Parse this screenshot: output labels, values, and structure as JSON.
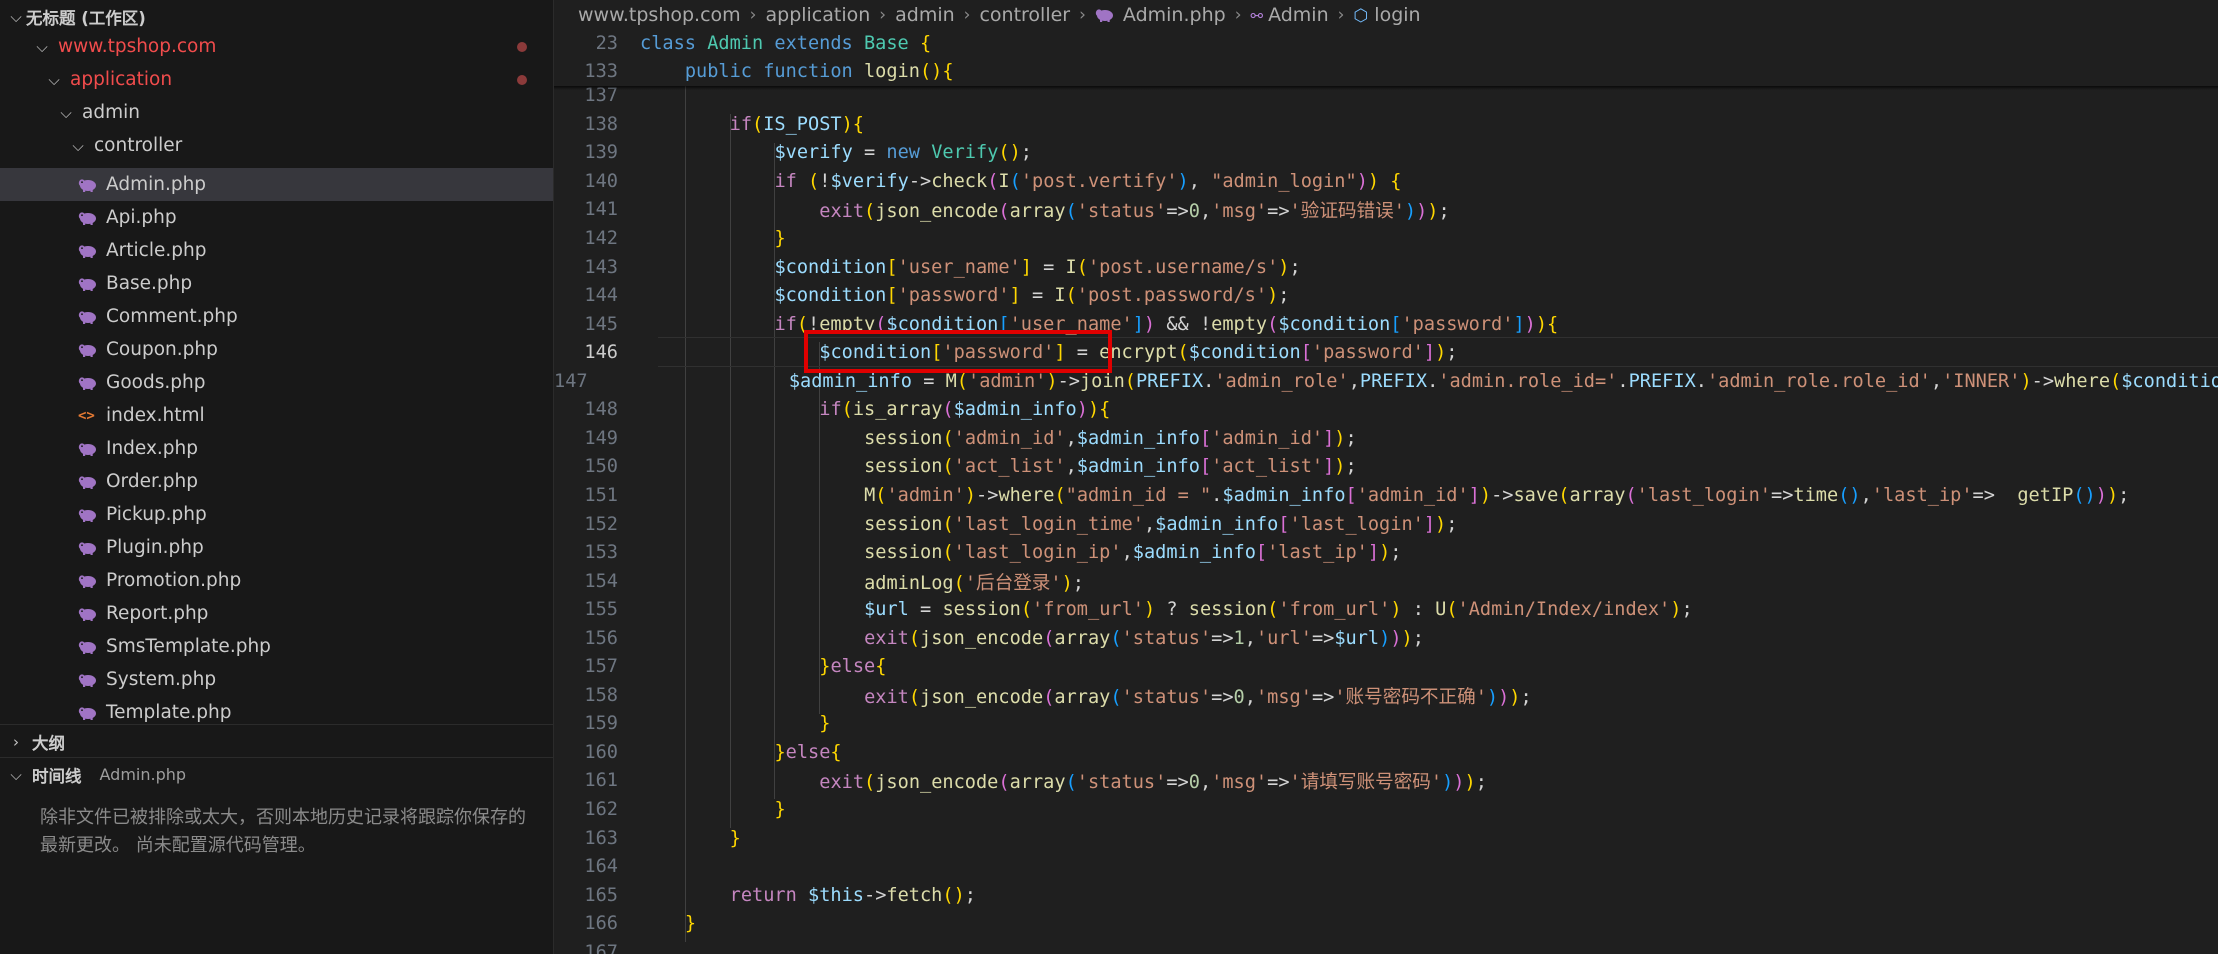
{
  "sidebar": {
    "workspace_title": "无标题 (工作区)",
    "root_folder": "www.tpshop.com",
    "folder_application": "application",
    "folder_admin": "admin",
    "folder_controller": "controller",
    "files": [
      "Admin.php",
      "Api.php",
      "Article.php",
      "Base.php",
      "Comment.php",
      "Coupon.php",
      "Goods.php",
      "index.html",
      "Index.php",
      "Order.php",
      "Pickup.php",
      "Plugin.php",
      "Promotion.php",
      "Report.php",
      "SmsTemplate.php",
      "System.php",
      "Template.php"
    ],
    "selected_file": "Admin.php",
    "outline_title": "大纲",
    "timeline_title": "时间线",
    "timeline_file": "Admin.php",
    "timeline_message": "除非文件已被排除或太大，否则本地历史记录将跟踪你保存的最新更改。 尚未配置源代码管理。"
  },
  "breadcrumb": {
    "items": [
      "www.tpshop.com",
      "application",
      "admin",
      "controller",
      "Admin.php",
      "Admin",
      "login"
    ]
  },
  "editor": {
    "current_line": 146,
    "sticky_lines": [
      {
        "n": "23",
        "code": "class Admin extends Base {"
      },
      {
        "n": "133",
        "code": "    public function login(){"
      }
    ],
    "lines": [
      {
        "n": "137",
        "code": ""
      },
      {
        "n": "138",
        "code": "        if(IS_POST){"
      },
      {
        "n": "139",
        "code": "            $verify = new Verify();"
      },
      {
        "n": "140",
        "code": "            if (!$verify->check(I('post.vertify'), \"admin_login\")) {"
      },
      {
        "n": "141",
        "code": "                exit(json_encode(array('status'=>0,'msg'=>'验证码错误')));"
      },
      {
        "n": "142",
        "code": "            }"
      },
      {
        "n": "143",
        "code": "            $condition['user_name'] = I('post.username/s');"
      },
      {
        "n": "144",
        "code": "            $condition['password'] = I('post.password/s');"
      },
      {
        "n": "145",
        "code": "            if(!empty($condition['user_name']) && !empty($condition['password'])){"
      },
      {
        "n": "146",
        "code": "                $condition['password'] = encrypt($condition['password']);"
      },
      {
        "n": "147",
        "code": "                $admin_info = M('admin')->join(PREFIX.'admin_role',PREFIX.'admin.role_id='.PREFIX.'admin_role.role_id','INNER')->where($condition)->find();"
      },
      {
        "n": "148",
        "code": "                if(is_array($admin_info)){"
      },
      {
        "n": "149",
        "code": "                    session('admin_id',$admin_info['admin_id']);"
      },
      {
        "n": "150",
        "code": "                    session('act_list',$admin_info['act_list']);"
      },
      {
        "n": "151",
        "code": "                    M('admin')->where(\"admin_id = \".$admin_info['admin_id'])->save(array('last_login'=>time(),'last_ip'=>  getIP()));"
      },
      {
        "n": "152",
        "code": "                    session('last_login_time',$admin_info['last_login']);"
      },
      {
        "n": "153",
        "code": "                    session('last_login_ip',$admin_info['last_ip']);"
      },
      {
        "n": "154",
        "code": "                    adminLog('后台登录');"
      },
      {
        "n": "155",
        "code": "                    $url = session('from_url') ? session('from_url') : U('Admin/Index/index');"
      },
      {
        "n": "156",
        "code": "                    exit(json_encode(array('status'=>1,'url'=>$url)));"
      },
      {
        "n": "157",
        "code": "                }else{"
      },
      {
        "n": "158",
        "code": "                    exit(json_encode(array('status'=>0,'msg'=>'账号密码不正确')));"
      },
      {
        "n": "159",
        "code": "                }"
      },
      {
        "n": "160",
        "code": "            }else{"
      },
      {
        "n": "161",
        "code": "                exit(json_encode(array('status'=>0,'msg'=>'请填写账号密码')));"
      },
      {
        "n": "162",
        "code": "            }"
      },
      {
        "n": "163",
        "code": "        }"
      },
      {
        "n": "164",
        "code": ""
      },
      {
        "n": "165",
        "code": "        return $this->fetch();"
      },
      {
        "n": "166",
        "code": "    }"
      },
      {
        "n": "167",
        "code": ""
      }
    ]
  },
  "colors": {
    "highlight_border": "#e00000",
    "modified_folder": "#f14c4c",
    "php_icon": "#a074c4"
  }
}
